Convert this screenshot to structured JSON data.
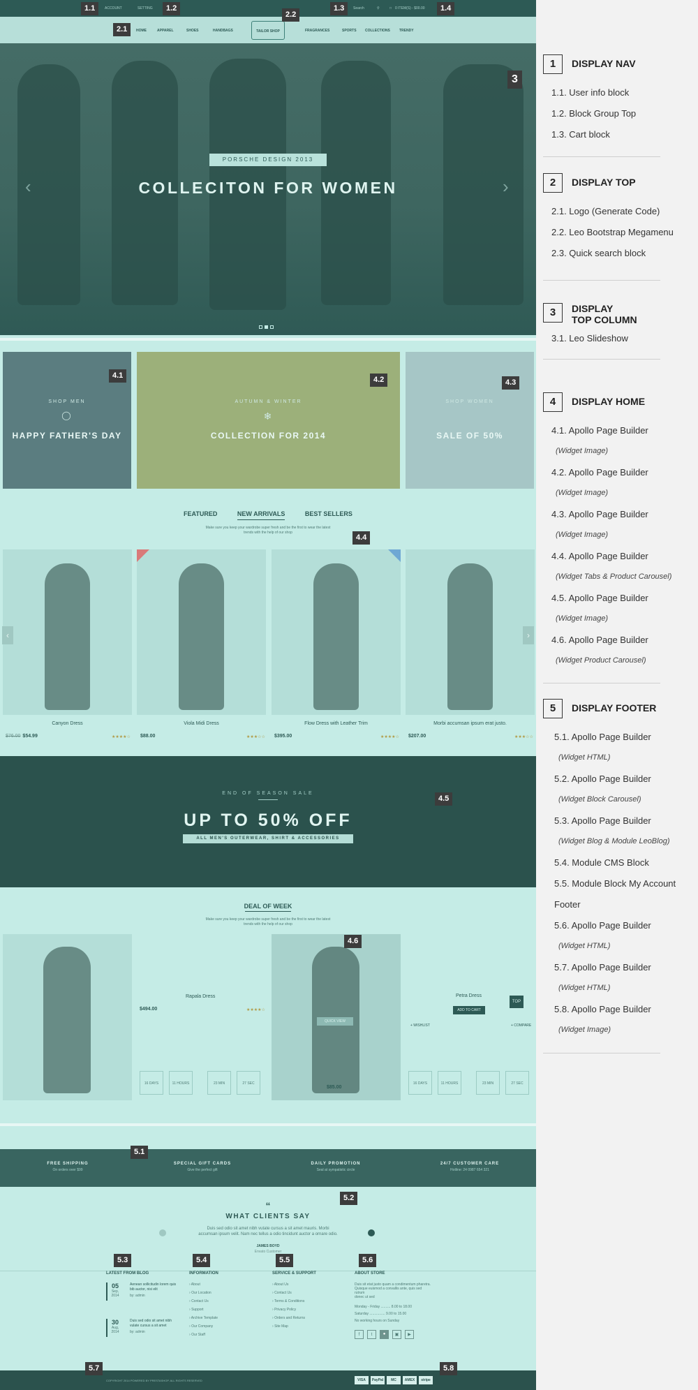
{
  "topbar": {
    "account": "ACCOUNT",
    "setting": "SETTING",
    "search": "Search",
    "cart": "0 ITEM(S) - $00.00"
  },
  "nav": {
    "items": [
      "HOME",
      "APPAREL",
      "SHOES",
      "HANDBAGS",
      "FRAGRANCES",
      "SPORTS",
      "COLLECTIONS",
      "TRENDY"
    ],
    "logo": "TAILOR SHOP"
  },
  "hero": {
    "eyebrow": "PORSCHE DESIGN 2013",
    "headline": "COLLECITON FOR WOMEN"
  },
  "banners": {
    "b1": {
      "sub": "SHOP MEN",
      "title": "HAPPY FATHER'S DAY"
    },
    "b2": {
      "sub": "AUTUMN & WINTER",
      "title": "COLLECTION FOR 2014"
    },
    "b3": {
      "sub": "SHOP WOMEN",
      "title": "SALE OF 50%"
    }
  },
  "tabs": {
    "items": [
      "FEATURED",
      "NEW ARRIVALS",
      "BEST SELLERS"
    ],
    "desc1": "Make sure you keep your wardrobe super fresh and be the first to wear the latest",
    "desc2": "trends with the help of our shop"
  },
  "products": [
    {
      "name": "Canyon Dress",
      "old": "$76.00",
      "price": "$54.99"
    },
    {
      "name": "Viola Midi Dress",
      "old": "",
      "price": "$88.00"
    },
    {
      "name": "Flow Dress with Leather Trim",
      "old": "",
      "price": "$395.00"
    },
    {
      "name": "Morbi accumsan ipsum erat justo.",
      "old": "",
      "price": "$207.00"
    }
  ],
  "sale": {
    "eyebrow": "END OF SEASON SALE",
    "headline": "UP TO 50% OFF",
    "pill": "ALL MEN'S OUTERWEAR, SHIRT & ACCESSORIES"
  },
  "deal": {
    "title": "DEAL OF WEEK",
    "desc1": "Make sure you keep your wardrobe super fresh and be the first to wear the latest",
    "desc2": "trends with the help of our shop",
    "p1": {
      "name": "Rapala Dress",
      "price": "$494.00"
    },
    "p2": {
      "name": "Petra Dress",
      "price": "$85.00"
    },
    "quick": "QUICK VIEW",
    "addcart": "ADD TO CART",
    "wishlist": "+ WISHLIST",
    "compare": "+ COMPARE",
    "top": "TOP",
    "countdown": [
      "16 DAYS",
      "11 HOURS",
      "23 MIN",
      "27 SEC"
    ]
  },
  "features": [
    {
      "title": "FREE SHIPPING",
      "sub": "On orders over $99"
    },
    {
      "title": "SPECIAL GIFT CARDS",
      "sub": "Give the perfect gift"
    },
    {
      "title": "DAILY PROMOTION",
      "sub": "Seal at sympatistic circle"
    },
    {
      "title": "24/7 CUSTOMER CARE",
      "sub": "Hotline: 24 0987 654 321"
    }
  ],
  "testimonial": {
    "title": "WHAT CLIENTS SAY",
    "text1": "Duis sed odio sit amet nibh vutate cursus a sit amet mauris. Morbi",
    "text2": "accumsan ipsum velit. Nam nec tellus a odio tincidunt auctor a ornare odio.",
    "author": "JAMES BOYD",
    "role": "Envato Customer"
  },
  "footer": {
    "blog": {
      "title": "LATEST FROM BLOG",
      "posts": [
        {
          "day": "05",
          "mon": "Sep, 2014",
          "text1": "Aenean sollicitudin lorem quis",
          "text2": "bib auctor, nisi elit",
          "by": "by: admin"
        },
        {
          "day": "30",
          "mon": "Aug, 2014",
          "text1": "Duis sed odio sit amet nibh",
          "text2": "vulate cursus a sit amet",
          "by": "by: admin"
        }
      ]
    },
    "info": {
      "title": "INFORMATION",
      "items": [
        "About",
        "Our Location",
        "Contact Us",
        "Support",
        "Archive Template",
        "Our Company",
        "Our Staff"
      ]
    },
    "service": {
      "title": "SERVICE & SUPPORT",
      "items": [
        "About Us",
        "Contact Us",
        "Terms & Conditions",
        "Privacy Policy",
        "Orders and Returns",
        "Site Map"
      ]
    },
    "about": {
      "title": "ABOUT STORE",
      "text1": "Duis sit etat justo quam a condimentum pharetra.",
      "text2": "Quisque euismod a convallis ante, quis sed rutrum",
      "text3": "donec ut sed",
      "hours1": "Monday - Friday .......... 8.00 to 18.00",
      "hours2": "Saturday ................ 9.00 to 15.00",
      "hours3": "No working hours on Sunday"
    }
  },
  "copyright": "COPYRIGHT 2014 POWERED BY PRESTASHOP. ALL RIGHTS RESERVED",
  "payments": [
    "VISA",
    "PayPal",
    "MC",
    "AMEX",
    "stripe"
  ],
  "badges": {
    "b11": "1.1",
    "b12": "1.2",
    "b13": "1.3",
    "b14": "1.4",
    "b21": "2.1",
    "b22": "2.2",
    "b3": "3",
    "b41": "4.1",
    "b42": "4.2",
    "b43": "4.3",
    "b44": "4.4",
    "b45": "4.5",
    "b46": "4.6",
    "b51": "5.1",
    "b52": "5.2",
    "b53": "5.3",
    "b54": "5.4",
    "b55": "5.5",
    "b56": "5.6",
    "b57": "5.7",
    "b58": "5.8"
  },
  "legend": {
    "s1": {
      "num": "1",
      "title": "DISPLAY NAV",
      "items": [
        "1.1. User info block",
        "1.2. Block Group Top",
        "1.3. Cart block"
      ]
    },
    "s2": {
      "num": "2",
      "title": "DISPLAY TOP",
      "items": [
        "2.1. Logo (Generate Code)",
        "2.2. Leo Bootstrap Megamenu",
        "2.3. Quick search block"
      ]
    },
    "s3": {
      "num": "3",
      "title1": "DISPLAY",
      "title2": "TOP COLUMN",
      "items": [
        "3.1. Leo Slideshow"
      ]
    },
    "s4": {
      "num": "4",
      "title": "DISPLAY HOME",
      "items": [
        {
          "main": "4.1. Apollo Page Builder",
          "sub": "(Widget Image)"
        },
        {
          "main": "4.2. Apollo Page Builder",
          "sub": "(Widget Image)"
        },
        {
          "main": "4.3. Apollo Page Builder",
          "sub": "(Widget Image)"
        },
        {
          "main": "4.4. Apollo Page Builder",
          "sub": "(Widget Tabs & Product Carousel)"
        },
        {
          "main": "4.5. Apollo Page Builder",
          "sub": "(Widget Image)"
        },
        {
          "main": "4.6. Apollo Page Builder",
          "sub": "(Widget Product Carousel)"
        }
      ]
    },
    "s5": {
      "num": "5",
      "title": "DISPLAY FOOTER",
      "items": [
        {
          "main": "5.1. Apollo Page Builder",
          "sub": "(Widget HTML)"
        },
        {
          "main": "5.2. Apollo Page Builder",
          "sub": "(Widget Block Carousel)"
        },
        {
          "main": "5.3. Apollo Page Builder",
          "sub": "(Widget Blog & Module LeoBlog)"
        },
        {
          "main": "5.4. Module CMS Block",
          "sub": ""
        },
        {
          "main": "5.5. Module Block My Account",
          "sub": "Footer"
        },
        {
          "main": "5.6. Apollo Page Builder",
          "sub": "(Widget HTML)"
        },
        {
          "main": "5.7. Apollo Page Builder",
          "sub": "(Widget HTML)"
        },
        {
          "main": "5.8. Apollo Page Builder",
          "sub": "(Widget Image)"
        }
      ]
    }
  },
  "colors": {
    "accent": "#2d5a55",
    "overlay": "#c5ece6",
    "badge": "#3c3c3c"
  }
}
